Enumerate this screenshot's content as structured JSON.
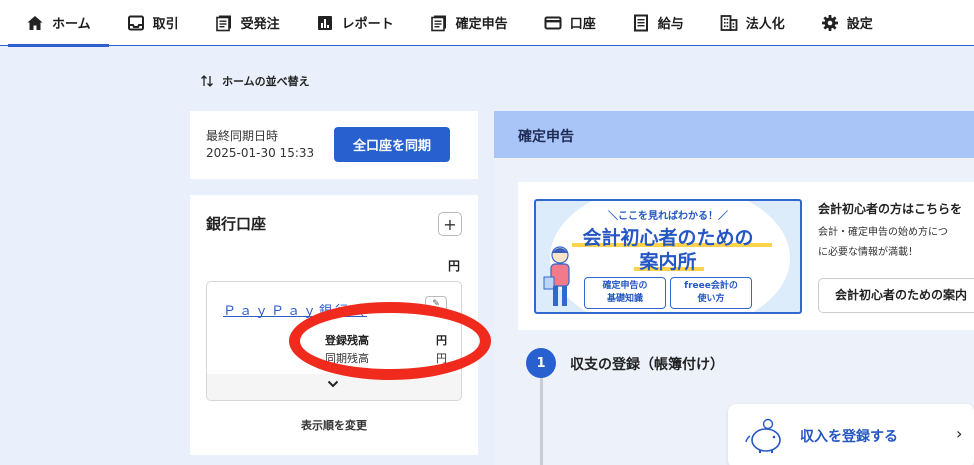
{
  "nav": {
    "items": [
      {
        "label": "ホーム",
        "icon": "home-icon"
      },
      {
        "label": "取引",
        "icon": "inbox-icon"
      },
      {
        "label": "受発注",
        "icon": "document-list-icon"
      },
      {
        "label": "レポート",
        "icon": "bar-chart-icon"
      },
      {
        "label": "確定申告",
        "icon": "document-list-icon"
      },
      {
        "label": "口座",
        "icon": "card-icon"
      },
      {
        "label": "給与",
        "icon": "payslip-icon"
      },
      {
        "label": "法人化",
        "icon": "building-icon"
      },
      {
        "label": "設定",
        "icon": "gear-icon"
      }
    ],
    "active_index": 0,
    "accent_color": "#2f5fd0"
  },
  "sort": {
    "label": "ホームの並べ替え"
  },
  "sync": {
    "label": "最終同期日時",
    "datetime": "2025-01-30 15:33",
    "button_label": "全口座を同期"
  },
  "bank": {
    "title": "銀行口座",
    "total_unit": "円",
    "account": {
      "name": "ＰａｙＰａｙ銀行（",
      "registered_label": "登録残高",
      "registered_unit": "円",
      "synced_label": "同期残高",
      "synced_unit": "円"
    },
    "reorder_label": "表示順を変更"
  },
  "kakutei": {
    "title": "確定申告",
    "banner": {
      "top_text": "＼ここを見ればわかる！／",
      "title_line1": "会計初心者のための",
      "title_line2": "案内所",
      "chip1_line1": "確定申告の",
      "chip1_line2": "基礎知識",
      "chip2_line1": "freee会計の",
      "chip2_line2": "使い方"
    },
    "promo_heading": "会計初心者の方はこちらを",
    "promo_desc_line1": "会計・確定申告の始め方につ",
    "promo_desc_line2": "に必要な情報が満載！",
    "promo_button": "会計初心者のための案内",
    "step": {
      "number": "1",
      "title": "収支の登録（帳簿付け）"
    },
    "income_label": "収入を登録する"
  }
}
